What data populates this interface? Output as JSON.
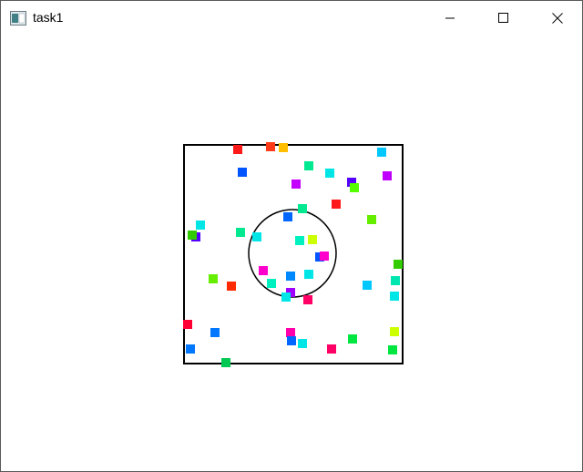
{
  "window": {
    "title": "task1",
    "icon": "app-window-icon",
    "controls": [
      "minimize-icon",
      "maximize-icon",
      "close-icon"
    ]
  },
  "scene": {
    "box_stroke": "#000000",
    "circle_stroke": "#000000",
    "particles": [
      {
        "color": "#ff1a1a"
      },
      {
        "color": "#ff3b1a"
      },
      {
        "color": "#ffbe00"
      },
      {
        "color": "#00c8ff"
      },
      {
        "color": "#0055ff"
      },
      {
        "color": "#00e890"
      },
      {
        "color": "#00e6e6"
      },
      {
        "color": "#5500ff"
      },
      {
        "color": "#c400ff"
      },
      {
        "color": "#c000ff"
      },
      {
        "color": "#55ff00"
      },
      {
        "color": "#ff1a1a"
      },
      {
        "color": "#00e890"
      },
      {
        "color": "#0066ff"
      },
      {
        "color": "#66ee00"
      },
      {
        "color": "#00e6e6"
      },
      {
        "color": "#5500ff"
      },
      {
        "color": "#33cc00"
      },
      {
        "color": "#00e890"
      },
      {
        "color": "#00e6e6"
      },
      {
        "color": "#00f0c0"
      },
      {
        "color": "#ccff00"
      },
      {
        "color": "#0055ff"
      },
      {
        "color": "#ff00cc"
      },
      {
        "color": "#66ee00"
      },
      {
        "color": "#ff2a00"
      },
      {
        "color": "#ff00cc"
      },
      {
        "color": "#0088ff"
      },
      {
        "color": "#00f0c0"
      },
      {
        "color": "#00e6e6"
      },
      {
        "color": "#00c8ff"
      },
      {
        "color": "#33cc00"
      },
      {
        "color": "#00e6b0"
      },
      {
        "color": "#00e6e6"
      },
      {
        "color": "#a000ff"
      },
      {
        "color": "#00e6e6"
      },
      {
        "color": "#ff0066"
      },
      {
        "color": "#ff0033"
      },
      {
        "color": "#0077ff"
      },
      {
        "color": "#ff00aa"
      },
      {
        "color": "#0066ff"
      },
      {
        "color": "#00e6e6"
      },
      {
        "color": "#00e640"
      },
      {
        "color": "#ccff00"
      },
      {
        "color": "#0077ff"
      },
      {
        "color": "#ff0066"
      },
      {
        "color": "#00e640"
      },
      {
        "color": "#00c850"
      }
    ]
  }
}
